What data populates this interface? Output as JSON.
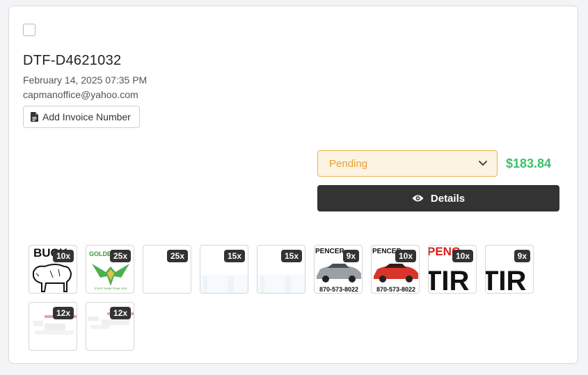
{
  "order": {
    "id": "DTF-D4621032",
    "date": "February 14, 2025 07:35 PM",
    "email": "capmanoffice@yahoo.com",
    "invoice_button_label": "Add Invoice Number",
    "invoice_icon": "document-icon"
  },
  "status": {
    "selected": "Pending",
    "chevron_icon": "chevron-down-icon",
    "accent_color": "#f0b24a",
    "background_color": "#fdf3e3"
  },
  "price": {
    "value": "$183.84",
    "color": "#3fbf6a"
  },
  "details_button": {
    "label": "Details",
    "icon": "eye-icon"
  },
  "thumbnails": [
    {
      "qty": "10x",
      "text": "BUCK"
    },
    {
      "qty": "25x",
      "text": "GOLDEN",
      "caption": "STATE SWIM TEAM 2025"
    },
    {
      "qty": "25x"
    },
    {
      "qty": "15x"
    },
    {
      "qty": "15x"
    },
    {
      "qty": "9x",
      "text": "PENCER",
      "phone": "870-573-8022"
    },
    {
      "qty": "10x",
      "text": "PENCER",
      "phone": "870-573-8022"
    },
    {
      "qty": "10x",
      "text": "PENC",
      "big": "TIR"
    },
    {
      "qty": "9x",
      "big": "TIR"
    },
    {
      "qty": "12x"
    },
    {
      "qty": "12x"
    }
  ]
}
